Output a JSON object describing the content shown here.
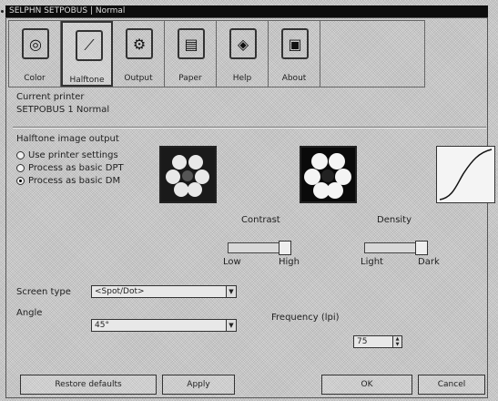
{
  "window": {
    "title": "SELPHN SETPOBUS | Normal"
  },
  "toolbar": {
    "items": [
      {
        "label": "Color",
        "icon": "color-wheel-icon",
        "glyph": "◎"
      },
      {
        "label": "Halftone",
        "icon": "halftone-curve-icon",
        "glyph": "⟋"
      },
      {
        "label": "Output",
        "icon": "output-icon",
        "glyph": "⚙"
      },
      {
        "label": "Paper",
        "icon": "paper-icon",
        "glyph": "▤"
      },
      {
        "label": "Help",
        "icon": "help-icon",
        "glyph": "◈"
      },
      {
        "label": "About",
        "icon": "about-icon",
        "glyph": "▣"
      }
    ]
  },
  "current_printer": {
    "label": "Current printer",
    "value": "SETPOBUS 1 Normal"
  },
  "halftone": {
    "section_label": "Halftone image output",
    "options": [
      {
        "label": "Use printer settings",
        "checked": false
      },
      {
        "label": "Process as basic DPT",
        "checked": false
      },
      {
        "label": "Process as basic DM",
        "checked": true
      }
    ]
  },
  "contrast": {
    "label": "Contrast",
    "low": "Low",
    "high": "High",
    "value": 0.85
  },
  "density": {
    "label": "Density",
    "low": "Light",
    "high": "Dark",
    "value": 0.85
  },
  "screen_type": {
    "label": "Screen type",
    "value": "<Spot/Dot>"
  },
  "angle": {
    "label": "Angle",
    "value": "45°"
  },
  "frequency": {
    "label": "Frequency (lpi)",
    "value": "75"
  },
  "buttons": {
    "restore": "Restore defaults",
    "apply": "Apply",
    "ok": "OK",
    "cancel": "Cancel"
  }
}
